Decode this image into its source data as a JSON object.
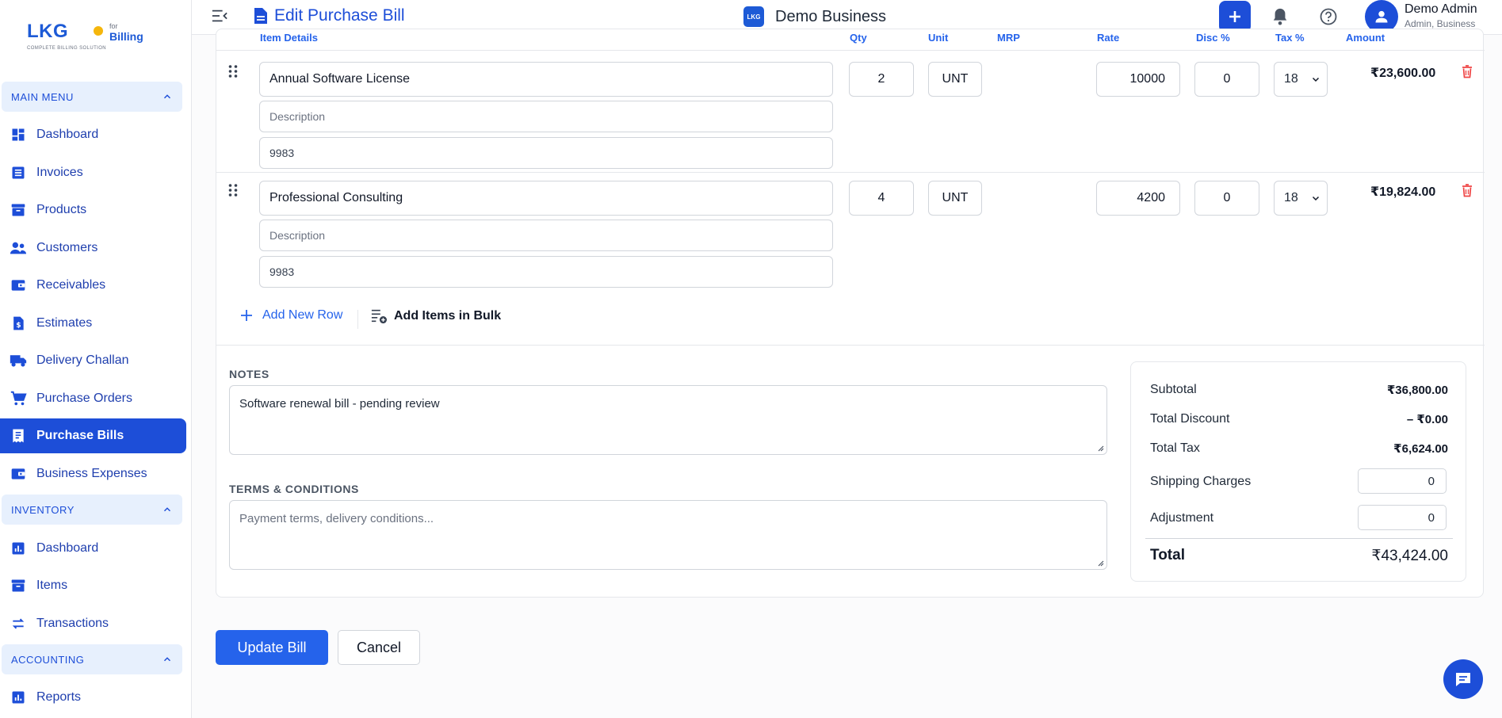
{
  "brand": {
    "logo_main": "LKG",
    "logo_for": "for",
    "logo_billing": "Billing",
    "logo_tagline": "COMPLETE BILLING SOLUTION",
    "accent_color": "#1d4ed8"
  },
  "header": {
    "page_title": "Edit Purchase Bill",
    "business_logo": "LKG",
    "business_name": "Demo Business",
    "user_name": "Demo Admin",
    "user_role": "Admin, Business"
  },
  "sidebar": {
    "sections": [
      {
        "label": "MAIN MENU",
        "items": [
          {
            "label": "Dashboard",
            "icon": "dashboard-icon"
          },
          {
            "label": "Invoices",
            "icon": "invoice-icon"
          },
          {
            "label": "Products",
            "icon": "archive-icon"
          },
          {
            "label": "Customers",
            "icon": "people-icon"
          },
          {
            "label": "Receivables",
            "icon": "wallet-icon"
          },
          {
            "label": "Estimates",
            "icon": "estimate-icon"
          },
          {
            "label": "Delivery Challan",
            "icon": "truck-icon"
          },
          {
            "label": "Purchase Orders",
            "icon": "cart-icon"
          },
          {
            "label": "Purchase Bills",
            "icon": "receipt-icon",
            "active": true
          },
          {
            "label": "Business Expenses",
            "icon": "wallet-icon"
          }
        ]
      },
      {
        "label": "INVENTORY",
        "items": [
          {
            "label": "Dashboard",
            "icon": "chart-icon"
          },
          {
            "label": "Items",
            "icon": "archive-icon"
          },
          {
            "label": "Transactions",
            "icon": "swap-icon"
          }
        ]
      },
      {
        "label": "ACCOUNTING",
        "items": [
          {
            "label": "Reports",
            "icon": "chart-icon"
          }
        ]
      }
    ]
  },
  "table": {
    "columns": [
      "Item Details",
      "Qty",
      "Unit",
      "MRP",
      "Rate",
      "Disc %",
      "Tax %",
      "Amount"
    ],
    "rows": [
      {
        "name": "Annual Software License",
        "description_placeholder": "Description",
        "hsn": "9983",
        "qty": "2",
        "unit": "UNT",
        "rate": "10000",
        "disc": "0",
        "tax": "18",
        "amount": "₹23,600.00"
      },
      {
        "name": "Professional Consulting",
        "description_placeholder": "Description",
        "hsn": "9983",
        "qty": "4",
        "unit": "UNT",
        "rate": "4200",
        "disc": "0",
        "tax": "18",
        "amount": "₹19,824.00"
      }
    ],
    "add_row_label": "Add New Row",
    "add_bulk_label": "Add Items in Bulk"
  },
  "notes": {
    "label": "NOTES",
    "value": "Software renewal bill - pending review"
  },
  "terms": {
    "label": "TERMS & CONDITIONS",
    "placeholder": "Payment terms, delivery conditions..."
  },
  "summary": {
    "subtotal_label": "Subtotal",
    "subtotal": "₹36,800.00",
    "discount_label": "Total Discount",
    "discount": "– ₹0.00",
    "tax_label": "Total Tax",
    "tax": "₹6,624.00",
    "shipping_label": "Shipping Charges",
    "shipping": "0",
    "adjustment_label": "Adjustment",
    "adjustment": "0",
    "total_label": "Total",
    "total": "₹43,424.00"
  },
  "actions": {
    "update_label": "Update Bill",
    "cancel_label": "Cancel"
  }
}
